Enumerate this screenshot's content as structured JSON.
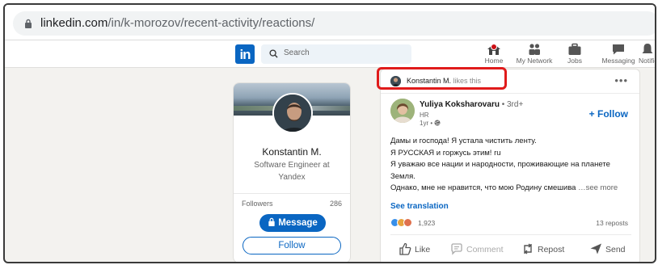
{
  "browser": {
    "url_host": "linkedin.com",
    "url_path": "/in/k-morozov/recent-activity/reactions/"
  },
  "navbar": {
    "logo": "in",
    "search_placeholder": "Search",
    "items": [
      {
        "label": "Home",
        "icon": "home-icon"
      },
      {
        "label": "My Network",
        "icon": "network-icon"
      },
      {
        "label": "Jobs",
        "icon": "briefcase-icon"
      },
      {
        "label": "Messaging",
        "icon": "chat-icon"
      },
      {
        "label": "Notific",
        "icon": "bell-icon"
      }
    ]
  },
  "profile": {
    "name": "Konstantin M.",
    "title": "Software Engineer at Yandex",
    "followers_label": "Followers",
    "followers_count": "286",
    "message_label": "Message",
    "follow_label": "Follow"
  },
  "activity": {
    "actor": "Konstantin M.",
    "action": "likes this",
    "more": "•••"
  },
  "post": {
    "author": "Yuliya Koksharova",
    "author_suffix": "ru",
    "degree": "• 3rd+",
    "headline": "HR",
    "time": "1yr •",
    "follow_label": "+ Follow",
    "lines": [
      "Дамы и господа! Я устала чистить ленту.",
      "Я РУССКАЯ и горжусь этим! ru",
      "Я уважаю все нации и народности, проживающие на планете",
      "Земля.",
      "Однако, мне не нравится, что мою Родину смешива"
    ],
    "see_more": "…see more",
    "see_translation": "See translation",
    "reaction_count": "1,923",
    "reposts": "13 reposts"
  },
  "actions": {
    "like": "Like",
    "comment": "Comment",
    "repost": "Repost",
    "send": "Send"
  },
  "colors": {
    "brand": "#0a66c2",
    "highlight": "#e01b1b",
    "page_bg": "#f3f2ef"
  }
}
